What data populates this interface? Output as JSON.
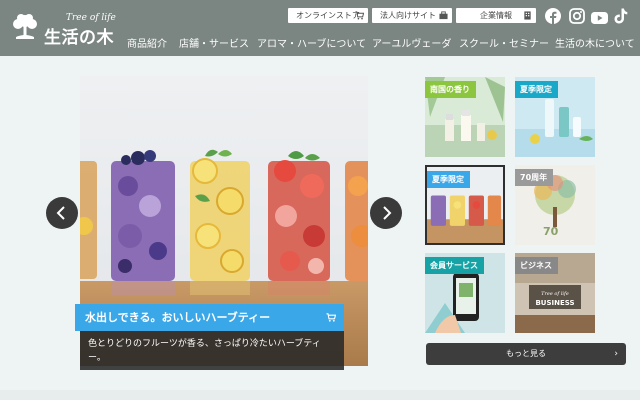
{
  "header": {
    "logo_sub": "Tree of life",
    "logo_main": "生活の木",
    "top_links": [
      {
        "label": "オンラインストア",
        "icon": "cart-icon"
      },
      {
        "label": "法人向けサイト",
        "icon": "briefcase-icon"
      },
      {
        "label": "企業情報",
        "icon": "building-icon"
      }
    ],
    "social": [
      "facebook-icon",
      "instagram-icon",
      "youtube-icon",
      "tiktok-icon"
    ],
    "nav": [
      "商品紹介",
      "店舗・サービス",
      "アロマ・ハーブについて",
      "アーユルヴェーダ",
      "スクール・セミナー",
      "生活の木について"
    ]
  },
  "hero": {
    "title": "水出しできる。おいしいハーブティー",
    "description": "色とりどりのフルーツが香る、さっぱり冷たいハーブティー。",
    "accent": "#3aa7e8"
  },
  "tiles": [
    {
      "label": "南国の香り",
      "color": "#8cc63f"
    },
    {
      "label": "夏季限定",
      "color": "#1aa8c9"
    },
    {
      "label": "夏季限定",
      "color": "#3aa7e8"
    },
    {
      "label": "70周年",
      "color": "#9a9a9a"
    },
    {
      "label": "会員サービス",
      "color": "#17a3a6"
    },
    {
      "label": "ビジネス",
      "color": "#888888"
    }
  ],
  "business_sign": {
    "sub": "Tree of life",
    "main": "BUSINESS"
  },
  "anniversary_mark": "70",
  "more_label": "もっと見る",
  "colors": {
    "header_bg": "#7b8582",
    "page_bg": "#eef4f3"
  }
}
